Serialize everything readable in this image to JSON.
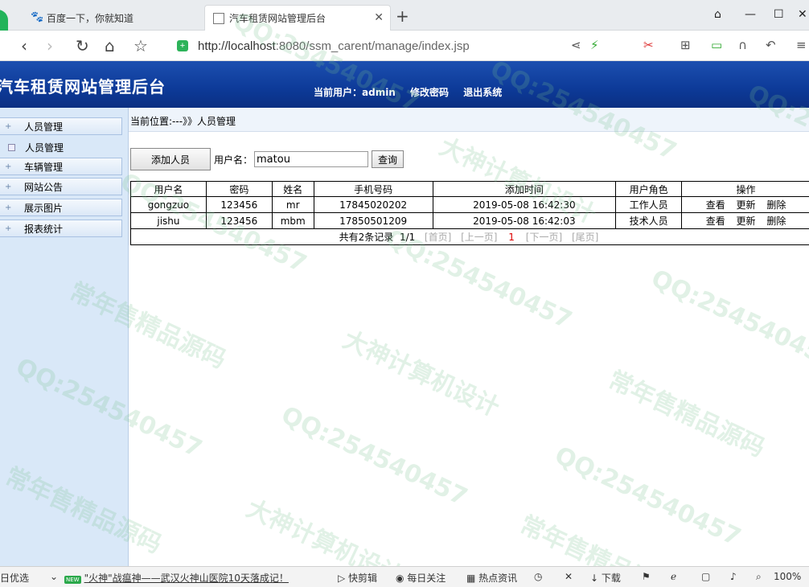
{
  "browser": {
    "tabs": [
      {
        "label": "百度一下，你就知道",
        "icon": "paw-icon"
      },
      {
        "label": "汽车租赁网站管理后台",
        "icon": "document-icon"
      }
    ],
    "url_host": "http://localhost",
    "url_path": ":8080/ssm_carent/manage/index.jsp"
  },
  "header": {
    "title": "汽车租赁网站管理后台",
    "current_user": "当前用户：admin",
    "change_password": "修改密码",
    "logout": "退出系统"
  },
  "sidebar": {
    "items": [
      {
        "label": "人员管理"
      },
      {
        "label": "车辆管理"
      },
      {
        "label": "网站公告"
      },
      {
        "label": "展示图片"
      },
      {
        "label": "报表统计"
      }
    ],
    "subitem": "人员管理"
  },
  "main": {
    "breadcrumb": "当前位置:---》》人员管理",
    "add_button": "添加人员",
    "search_label": "用户名：",
    "search_value": "matou",
    "search_button": "查询",
    "columns": [
      "用户名",
      "密码",
      "姓名",
      "手机号码",
      "添加时间",
      "用户角色",
      "操作"
    ],
    "rows": [
      {
        "username": "gongzuo",
        "password": "123456",
        "name": "mr",
        "phone": "17845020202",
        "added": "2019-05-08 16:42:30",
        "role": "工作人员"
      },
      {
        "username": "jishu",
        "password": "123456",
        "name": "mbm",
        "phone": "17850501209",
        "added": "2019-05-08 16:42:03",
        "role": "技术人员"
      }
    ],
    "ops": {
      "view": "查看",
      "update": "更新",
      "delete": "删除"
    },
    "pager": {
      "total": "共有2条记录",
      "page": "1/1",
      "first": "[首页]",
      "prev": "[上一页]",
      "current": "1",
      "next": "[下一页]",
      "last": "[尾页]"
    }
  },
  "watermarks": [
    "QQ:254540457",
    "大神计算机设计",
    "常年售精品源码"
  ],
  "statusbar": {
    "left": "日优选",
    "news": "\"火神\"战瘟神——武汉火神山医院10天落成记！",
    "items": [
      "快剪辑",
      "每日关注",
      "热点资讯",
      "下载"
    ],
    "zoom": "100%"
  }
}
